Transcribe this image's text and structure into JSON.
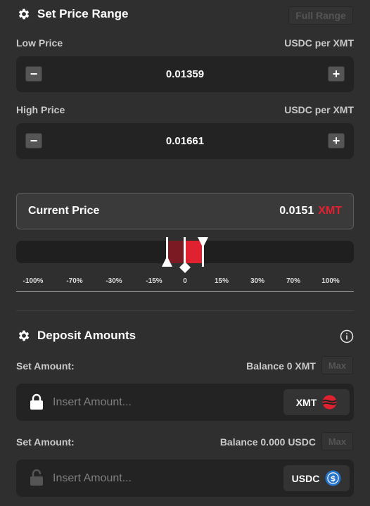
{
  "range": {
    "title": "Set Price Range",
    "full_range_label": "Full Range",
    "low": {
      "label": "Low Price",
      "unit": "USDC per XMT",
      "value": "0.01359",
      "minus": "−",
      "plus": "+"
    },
    "high": {
      "label": "High Price",
      "unit": "USDC per XMT",
      "value": "0.01661",
      "minus": "−",
      "plus": "+"
    }
  },
  "current": {
    "label": "Current Price",
    "value": "0.0151",
    "token": "XMT"
  },
  "slider": {
    "ticks": [
      "-100%",
      "-70%",
      "-30%",
      "-15%",
      "0",
      "15%",
      "30%",
      "70%",
      "100%"
    ],
    "colors": {
      "range_fill": "#e0212f",
      "range_dark": "#7b1a22",
      "track": "#1f1f1f"
    }
  },
  "deposit": {
    "title": "Deposit Amounts",
    "rows": [
      {
        "set_label": "Set Amount:",
        "balance": "Balance 0 XMT",
        "max": "Max",
        "placeholder": "Insert Amount...",
        "token": "XMT",
        "icon": "xmt-token-icon"
      },
      {
        "set_label": "Set Amount:",
        "balance": "Balance 0.000 USDC",
        "max": "Max",
        "placeholder": "Insert Amount...",
        "token": "USDC",
        "icon": "usdc-token-icon"
      }
    ]
  },
  "colors": {
    "accent": "#e0212f",
    "background": "#2f2f2f",
    "panel": "#232323",
    "usdc_blue": "#2775ca"
  }
}
